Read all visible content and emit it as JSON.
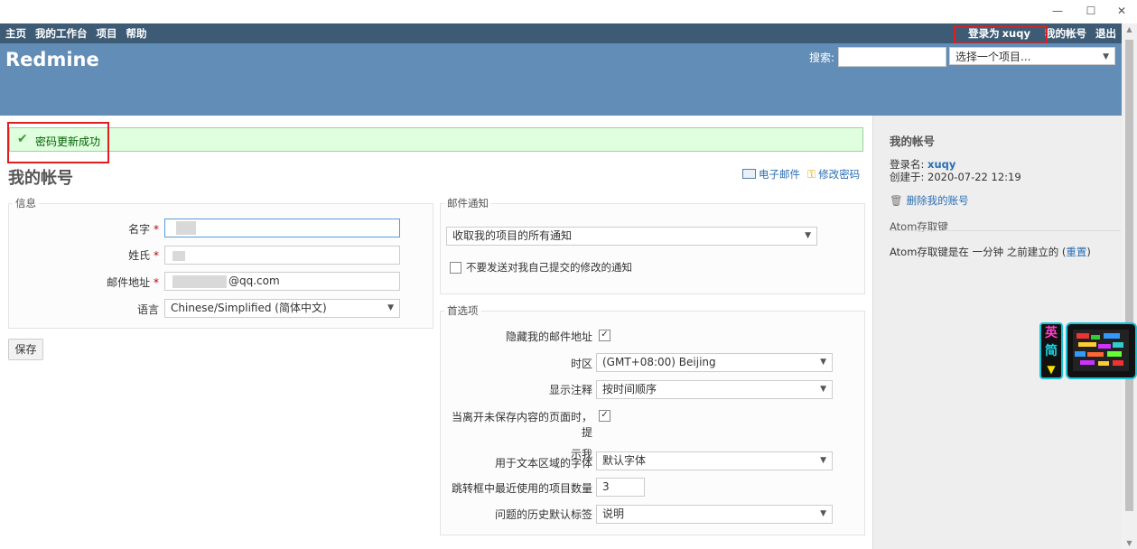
{
  "window": {
    "minimize_glyph": "—",
    "maximize_glyph": "☐",
    "close_glyph": "✕"
  },
  "top_menu": {
    "items": [
      "主页",
      "我的工作台",
      "项目",
      "帮助"
    ],
    "loggedas_prefix": "登录为",
    "loggedas_user": "xuqy",
    "my_account": "我的帐号",
    "logout": "退出"
  },
  "header": {
    "site_title": "Redmine",
    "search_label": "搜索:",
    "search_value": "",
    "project_select": "选择一个项目..."
  },
  "flash": {
    "icon": "check-icon",
    "text": "密码更新成功"
  },
  "page": {
    "title": "我的帐号",
    "email_link": "电子邮件",
    "change_password_link": "修改密码"
  },
  "info": {
    "legend": "信息",
    "firstname_label": "名字",
    "lastname_label": "姓氏",
    "mail_label": "邮件地址",
    "mail_value": "@qq.com",
    "language_label": "语言",
    "language_value": "Chinese/Simplified (简体中文)",
    "required_mark": "*"
  },
  "save_button": "保存",
  "mail_notification": {
    "legend": "邮件通知",
    "select_value": "收取我的项目的所有通知",
    "no_self_notified_label": "不要发送对我自己提交的修改的通知",
    "no_self_notified_checked": false
  },
  "preferences": {
    "legend": "首选项",
    "hide_mail_label": "隐藏我的邮件地址",
    "hide_mail_checked": true,
    "timezone_label": "时区",
    "timezone_value": "(GMT+08:00) Beijing",
    "comments_sorting_label": "显示注释",
    "comments_sorting_value": "按时间顺序",
    "warn_unsaved_label_line1": "当离开未保存内容的页面时，提",
    "warn_unsaved_label_line2": "示我",
    "warn_unsaved_checked": true,
    "textarea_font_label": "用于文本区域的字体",
    "textarea_font_value": "默认字体",
    "recent_projects_label": "跳转框中最近使用的项目数量",
    "recent_projects_value": "3",
    "history_tab_label": "问题的历史默认标签",
    "history_tab_value": "说明"
  },
  "sidebar": {
    "title": "我的帐号",
    "login_label": "登录名:",
    "login_value": "xuqy",
    "created_label": "创建于:",
    "created_value": "2020-07-22 12:19",
    "delete_account": "删除我的账号",
    "atom_title": "Atom存取键",
    "atom_text": "Atom存取键是在 一分钟 之前建立的",
    "atom_reset": "重置",
    "paren_open": "(",
    "paren_close": ")"
  },
  "ime_widget": {
    "lang": "英",
    "mode": "简",
    "shirt": "👕"
  },
  "colors": {
    "top_menu": "#3e5b76",
    "header": "#628db6",
    "flash_bg": "#dfffdf",
    "link": "#2b6fb5",
    "highlight_box": "#e01e1e"
  }
}
